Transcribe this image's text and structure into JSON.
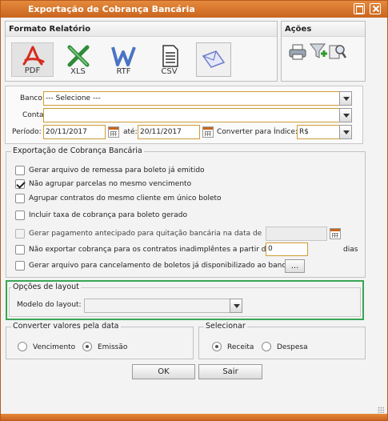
{
  "window": {
    "title": "Exportação de Cobrança Bancária"
  },
  "formato": {
    "title": "Formato Relatório",
    "buttons": [
      {
        "label": "PDF"
      },
      {
        "label": "XLS"
      },
      {
        "label": "RTF"
      },
      {
        "label": "CSV"
      },
      {
        "label": ""
      }
    ]
  },
  "acoes": {
    "title": "Ações"
  },
  "filtros": {
    "banco_label": "Banco:",
    "banco_value": "--- Selecione ---",
    "conta_label": "Conta:",
    "conta_value": "",
    "periodo_label": "Período:",
    "periodo_inicio": "20/11/2017",
    "ate_label": "até:",
    "periodo_fim": "20/11/2017",
    "indice_label": "Converter para Índice:",
    "indice_value": "R$"
  },
  "exportacao": {
    "legend": "Exportação de Cobrança Bancária",
    "options": [
      {
        "label": "Gerar arquivo de remessa para boleto já emitido",
        "checked": false,
        "disabled": false
      },
      {
        "label": "Não agrupar parcelas no mesmo vencimento",
        "checked": true,
        "disabled": false
      },
      {
        "label": "Agrupar contratos do mesmo cliente em único boleto",
        "checked": false,
        "disabled": false
      },
      {
        "label": "Incluir taxa de cobrança para boleto gerado",
        "checked": false,
        "disabled": false
      },
      {
        "label": "Gerar pagamento antecipado para quitação bancária na data de",
        "checked": false,
        "disabled": true
      },
      {
        "label": "Não exportar cobrança para os contratos inadimplêntes a partir de",
        "checked": false,
        "disabled": false
      },
      {
        "label": "Gerar arquivo para cancelamento de boletos já disponibilizado ao banco",
        "checked": false,
        "disabled": false
      }
    ],
    "dias_value": "0",
    "dias_label": "dias",
    "ellipsis_label": "..."
  },
  "layout": {
    "legend": "Opções de layout",
    "modelo_label": "Modelo do layout:",
    "modelo_value": ""
  },
  "converter": {
    "legend": "Converter valores pela data",
    "opt1": "Vencimento",
    "opt2": "Emissão",
    "selected": "Emissão"
  },
  "selecionar": {
    "legend": "Selecionar",
    "opt1": "Receita",
    "opt2": "Despesa",
    "selected": "Receita"
  },
  "actions": {
    "ok": "OK",
    "sair": "Sair"
  }
}
